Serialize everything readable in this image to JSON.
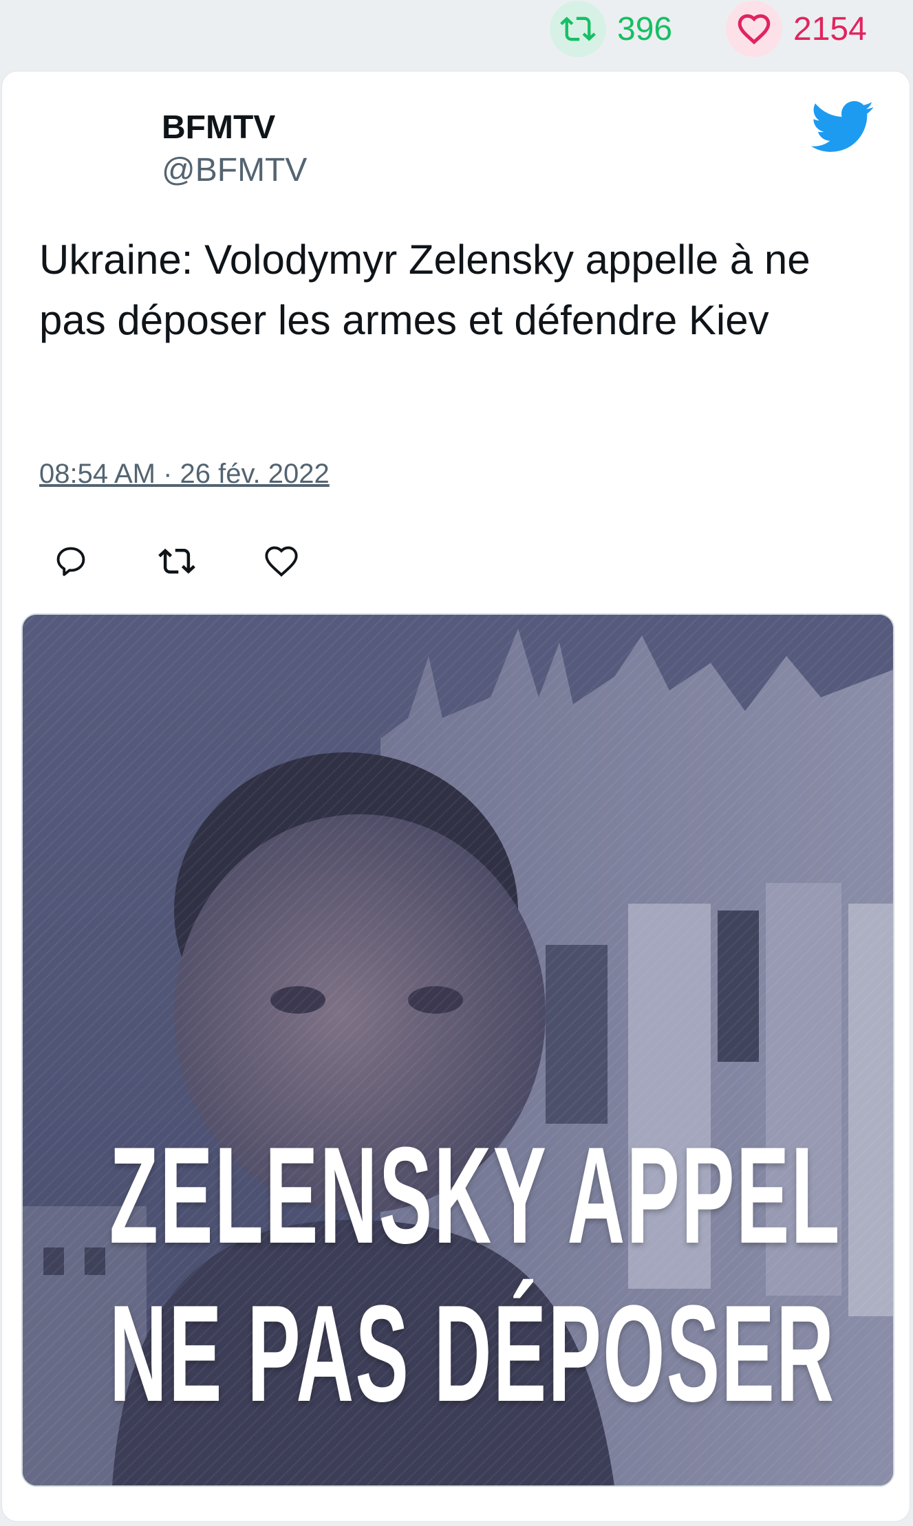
{
  "top_stats": {
    "retweet_count": "396",
    "like_count": "2154",
    "retweet_color": "#17bf63",
    "like_color": "#e0245e"
  },
  "tweet": {
    "author_name": "BFMTV",
    "author_handle": "@BFMTV",
    "text": "Ukraine: Volodymyr Zelensky appelle à ne pas déposer les armes et défendre Kiev",
    "timestamp": "08:54 AM · 26 fév. 2022",
    "brand_icon": "twitter-bird-icon",
    "brand_color": "#1d9bf0",
    "actions": [
      {
        "name": "reply",
        "icon": "reply-icon"
      },
      {
        "name": "retweet",
        "icon": "retweet-icon"
      },
      {
        "name": "like",
        "icon": "heart-icon"
      }
    ]
  },
  "media": {
    "overlay_line1": "ZELENSKY APPEL",
    "overlay_line2": "NE PAS DÉPOSER"
  }
}
